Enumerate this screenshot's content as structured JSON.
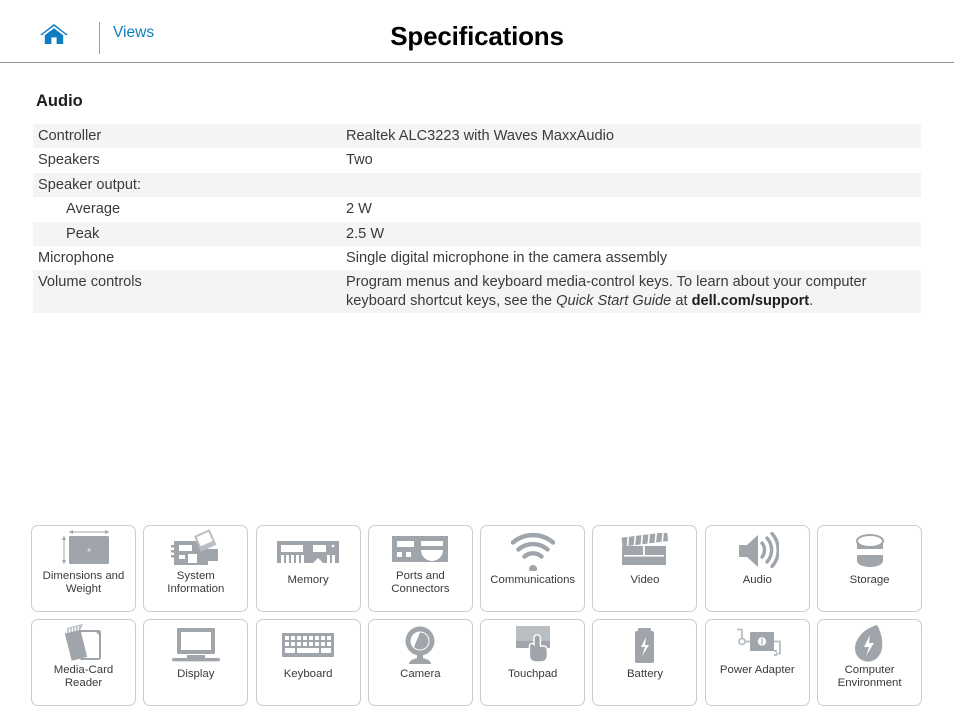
{
  "header": {
    "home_icon": "home-icon",
    "views_label": "Views",
    "title": "Specifications"
  },
  "section": {
    "title": "Audio"
  },
  "spec_table": {
    "rows": [
      {
        "key": "Controller",
        "value": "Realtek ALC3223 with Waves MaxxAudio",
        "shaded": true,
        "indent": false
      },
      {
        "key": "Speakers",
        "value": "Two",
        "shaded": false,
        "indent": false
      },
      {
        "key": "Speaker output:",
        "value": "",
        "shaded": true,
        "indent": false
      },
      {
        "key": "Average",
        "value": "2 W",
        "shaded": false,
        "indent": true
      },
      {
        "key": "Peak",
        "value": "2.5 W",
        "shaded": true,
        "indent": true
      },
      {
        "key": "Microphone",
        "value": "Single digital microphone in the camera assembly",
        "shaded": false,
        "indent": false
      }
    ],
    "volume_row": {
      "key": "Volume controls",
      "text_1": "Program menus and keyboard media-control keys. To learn about your computer keyboard shortcut keys, see the ",
      "italic": "Quick Start Guide",
      "text_2": " at ",
      "bold": "dell.com/support",
      "text_3": "."
    }
  },
  "tiles": [
    {
      "label": "Dimensions and Weight",
      "icon": "laptop-dimensions-icon"
    },
    {
      "label": "System Information",
      "icon": "motherboard-icon"
    },
    {
      "label": "Memory",
      "icon": "memory-module-icon"
    },
    {
      "label": "Ports and Connectors",
      "icon": "ports-icon"
    },
    {
      "label": "Communications",
      "icon": "wifi-icon"
    },
    {
      "label": "Video",
      "icon": "clapperboard-icon"
    },
    {
      "label": "Audio",
      "icon": "speaker-icon"
    },
    {
      "label": "Storage",
      "icon": "hard-drive-icon"
    },
    {
      "label": "Media-Card Reader",
      "icon": "media-card-icon"
    },
    {
      "label": "Display",
      "icon": "monitor-icon"
    },
    {
      "label": "Keyboard",
      "icon": "keyboard-icon"
    },
    {
      "label": "Camera",
      "icon": "camera-icon"
    },
    {
      "label": "Touchpad",
      "icon": "touchpad-icon"
    },
    {
      "label": "Battery",
      "icon": "battery-icon"
    },
    {
      "label": "Power Adapter",
      "icon": "power-adapter-icon"
    },
    {
      "label": "Computer Environment",
      "icon": "leaf-icon"
    }
  ],
  "colors": {
    "accent_blue": "#0f7dc2",
    "row_shade": "#f4f4f4",
    "icon_gray": "#9fa5ab",
    "tile_border": "#c9ccd0"
  }
}
